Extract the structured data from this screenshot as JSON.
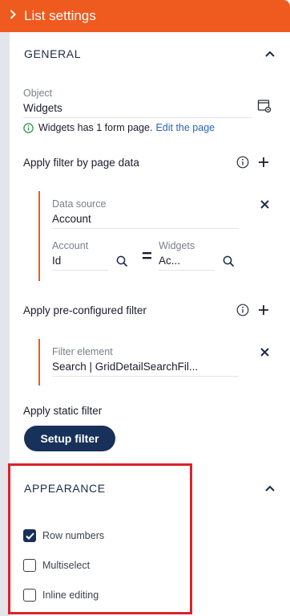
{
  "header": {
    "title": "List settings",
    "chevron_icon": "chevron-right-icon"
  },
  "general": {
    "title": "GENERAL",
    "object_label": "Object",
    "object_value": "Widgets",
    "info_text": "Widgets has 1 form page.",
    "info_link": "Edit the page",
    "page_data_filter": {
      "title": "Apply filter by page data",
      "data_source_label": "Data source",
      "data_source_value": "Account",
      "left_label": "Account",
      "left_value": "Id",
      "operator": "=",
      "right_label": "Widgets",
      "right_value": "Ac..."
    },
    "preconfigured_filter": {
      "title": "Apply pre-configured filter",
      "element_label": "Filter element",
      "element_value": "Search | GridDetailSearchFil..."
    },
    "static_filter": {
      "title": "Apply static filter",
      "button_label": "Setup filter"
    }
  },
  "appearance": {
    "title": "APPEARANCE",
    "options": [
      {
        "label": "Row numbers",
        "checked": true
      },
      {
        "label": "Multiselect",
        "checked": false
      },
      {
        "label": "Inline editing",
        "checked": false
      }
    ]
  },
  "colors": {
    "accent": "#ef5a1f",
    "primary": "#17315a",
    "link": "#2a64b8",
    "highlight": "#d9232a",
    "success": "#2e8b3a"
  }
}
